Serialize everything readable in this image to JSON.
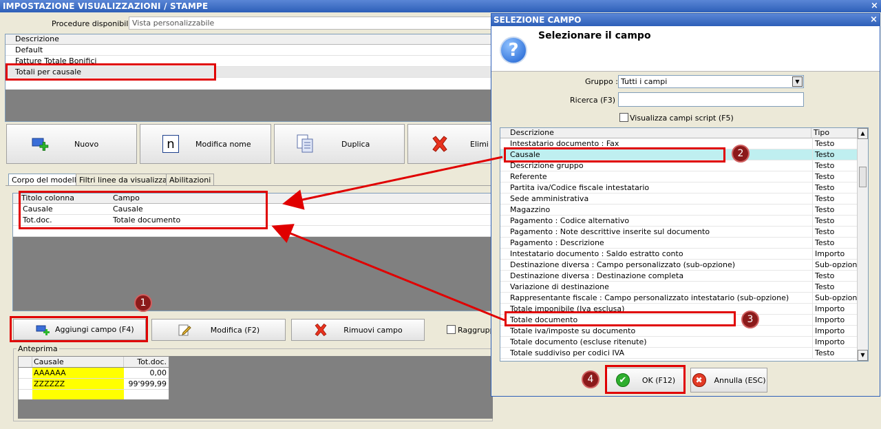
{
  "window": {
    "title": "IMPOSTAZIONE VISUALIZZAZIONI / STAMPE"
  },
  "procedure": {
    "label": "Procedure disponibili :",
    "value": "Vista personalizzabile"
  },
  "models": {
    "header": "Descrizione",
    "rows": [
      "Default",
      "Fatture Totale Bonifici",
      "Totali per causale"
    ]
  },
  "toolbar": {
    "nuovo": "Nuovo",
    "modifica_nome": "Modifica nome",
    "duplica": "Duplica",
    "elimina": "Elimi"
  },
  "tabs": [
    "Corpo del modello",
    "Filtri linee da visualizzare",
    "Abilitazioni"
  ],
  "columns": {
    "headers": [
      "Titolo colonna",
      "Campo"
    ],
    "rows": [
      [
        "Causale",
        "Causale"
      ],
      [
        "Tot.doc.",
        "Totale documento"
      ]
    ]
  },
  "actions": {
    "aggiungi": "Aggiungi campo (F4)",
    "modifica": "Modifica (F2)",
    "rimuovi": "Rimuovi campo",
    "raggruppa": "Raggruppa"
  },
  "preview": {
    "legend": "Anteprima",
    "headers": [
      "Causale",
      "Tot.doc."
    ],
    "rows": [
      [
        "AAAAAA",
        "0,00"
      ],
      [
        "ZZZZZZ",
        "99'999,99"
      ]
    ]
  },
  "dialog": {
    "title": "SELEZIONE CAMPO",
    "close": "×",
    "heading": "Selezionare il campo",
    "gruppo_label": "Gruppo :",
    "gruppo_value": "Tutti i campi",
    "ricerca_label": "Ricerca (F3) :",
    "ricerca_value": "",
    "script_label": "Visualizza campi script (F5)",
    "list_headers": [
      "Descrizione",
      "Tipo"
    ],
    "fields": [
      [
        "Intestatario documento : Fax",
        "Testo"
      ],
      [
        "Causale",
        "Testo"
      ],
      [
        "Descrizione gruppo",
        "Testo"
      ],
      [
        "Referente",
        "Testo"
      ],
      [
        "Partita iva/Codice fiscale intestatario",
        "Testo"
      ],
      [
        "Sede amministrativa",
        "Testo"
      ],
      [
        "Magazzino",
        "Testo"
      ],
      [
        "Pagamento : Codice alternativo",
        "Testo"
      ],
      [
        "Pagamento : Note descrittive inserite sul documento",
        "Testo"
      ],
      [
        "Pagamento : Descrizione",
        "Testo"
      ],
      [
        "Intestatario documento : Saldo estratto conto",
        "Importo"
      ],
      [
        "Destinazione diversa : Campo personalizzato (sub-opzione)",
        "Sub-opzione"
      ],
      [
        "Destinazione diversa : Destinazione completa",
        "Testo"
      ],
      [
        "Variazione di destinazione",
        "Testo"
      ],
      [
        "Rappresentante fiscale : Campo personalizzato intestatario (sub-opzione)",
        "Sub-opzione"
      ],
      [
        "Totale imponibile (Iva esclusa)",
        "Importo"
      ],
      [
        "Totale documento",
        "Importo"
      ],
      [
        "Totale iva/imposte su documento",
        "Importo"
      ],
      [
        "Totale documento (escluse ritenute)",
        "Importo"
      ],
      [
        "Totale suddiviso per codici IVA",
        "Testo"
      ]
    ],
    "ok": "OK (F12)",
    "annulla": "Annulla (ESC)"
  },
  "markers": [
    "1",
    "2",
    "3",
    "4"
  ],
  "icons": {
    "nuovo": "add-window-icon",
    "modifica_nome": "n",
    "duplica": "copy-icon",
    "elimina": "red-x-icon",
    "aggiungi": "add-column-icon",
    "modifica": "edit-icon",
    "rimuovi": "red-x-icon",
    "question": "?",
    "ok": "check-icon",
    "annulla": "cancel-icon"
  },
  "colors": {
    "highlight": "#e00000",
    "marker": "#8b1a1a",
    "selected_row": "#bfeff0",
    "preview_yellow": "#ffff00"
  }
}
